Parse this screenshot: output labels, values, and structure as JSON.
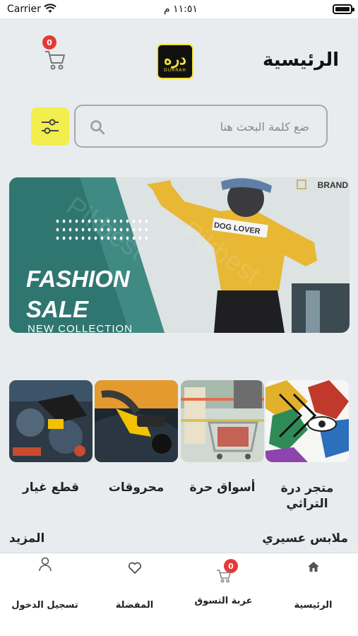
{
  "status_bar": {
    "carrier": "Carrier",
    "time": "١١:٥١ م"
  },
  "header": {
    "title": "الرئيسية",
    "cart_count": "0",
    "logo_mark": "دره",
    "logo_word": "DURRAH"
  },
  "search": {
    "placeholder": "ضع كلمة البحث هنا",
    "value": ""
  },
  "banner": {
    "title_line1": "FASHION",
    "title_line2": "SALE",
    "subtitle": "NEW COLLECTION",
    "brand": "BRAND",
    "shirt_text": "DOG LOVER",
    "watermark": "Pikbest"
  },
  "categories": [
    {
      "label": "متجر درة التراثي",
      "image": "heritage-pattern-image"
    },
    {
      "label": "أسواق حرة",
      "image": "shopping-cart-image"
    },
    {
      "label": "محروقات",
      "image": "fuel-pump-image"
    },
    {
      "label": "قطع غيار",
      "image": "engine-parts-image"
    }
  ],
  "section": {
    "title": "ملابس عسيري",
    "more": "المزيد"
  },
  "bottom_nav": {
    "home": "الرئيسية",
    "cart": "عربة التسوق",
    "cart_count": "0",
    "favorites": "المفضلة",
    "login": "تسجيل الدخول"
  },
  "colors": {
    "accent": "#f1ee4e",
    "badge": "#e53935",
    "background": "#e8ecee",
    "banner_teal": "#2f7670"
  }
}
